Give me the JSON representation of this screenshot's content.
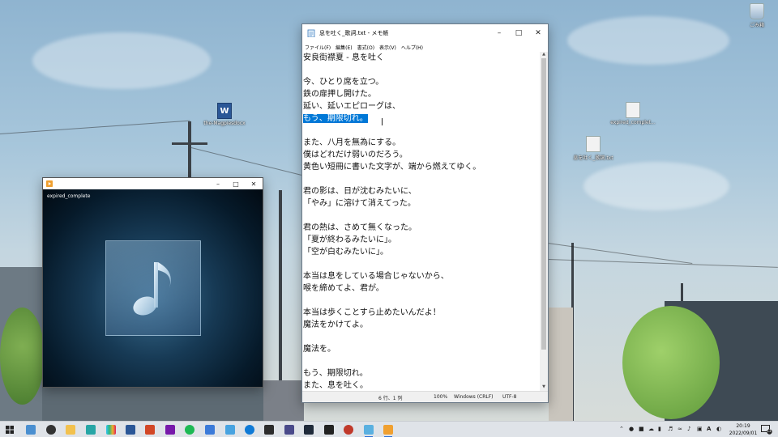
{
  "desktop": {
    "icons": [
      {
        "name": "recycle-bin",
        "label": "ごみ箱"
      },
      {
        "name": "docx-file",
        "label": "the-Magpiesdocx"
      },
      {
        "name": "expired-file",
        "label": "expired_complet..."
      },
      {
        "name": "txt-file",
        "label": "息を吐く_歌詞.txt"
      }
    ]
  },
  "notepad": {
    "title": "息を吐く_歌詞.txt - メモ帳",
    "menu": [
      "ファイル(F)",
      "編集(E)",
      "書式(O)",
      "表示(V)",
      "ヘルプ(H)"
    ],
    "lines": [
      "安良街襟夏 ‐ 息を吐く",
      "",
      "今、ひとり席を立つ。",
      "鉄の扉押し開けた。",
      "延い、延いエピローグは、",
      "もう、期限切れ。",
      "",
      "また、八月を無為にする。",
      "僕はどれだけ弱いのだろう。",
      "黄色い短冊に書いた文字が、端から燃えてゆく。",
      "",
      "君の影は、日が沈むみたいに、",
      "「やみ」に溶けて消えてった。",
      "",
      "君の熱は、さめて無くなった。",
      "「夏が終わるみたいに」。",
      "「空が白むみたいに」。",
      "",
      "本当は息をしている場合じゃないから、",
      "喉を締めてよ、君が。",
      "",
      "本当は歩くことすら止めたいんだよ！",
      "魔法をかけてよ。",
      "",
      "魔法を。",
      "",
      "もう、期限切れ。",
      "また、息を吐く。"
    ],
    "selected_line": 5,
    "status": {
      "position": "6 行、1 列",
      "zoom": "100%",
      "line_ending": "Windows (CRLF)",
      "encoding": "UTF-8"
    }
  },
  "player": {
    "track_title": "expired_complete"
  },
  "taskbar": {
    "time": "20:19",
    "date": "2022/09/01",
    "ime": "A",
    "notifications": "13"
  }
}
